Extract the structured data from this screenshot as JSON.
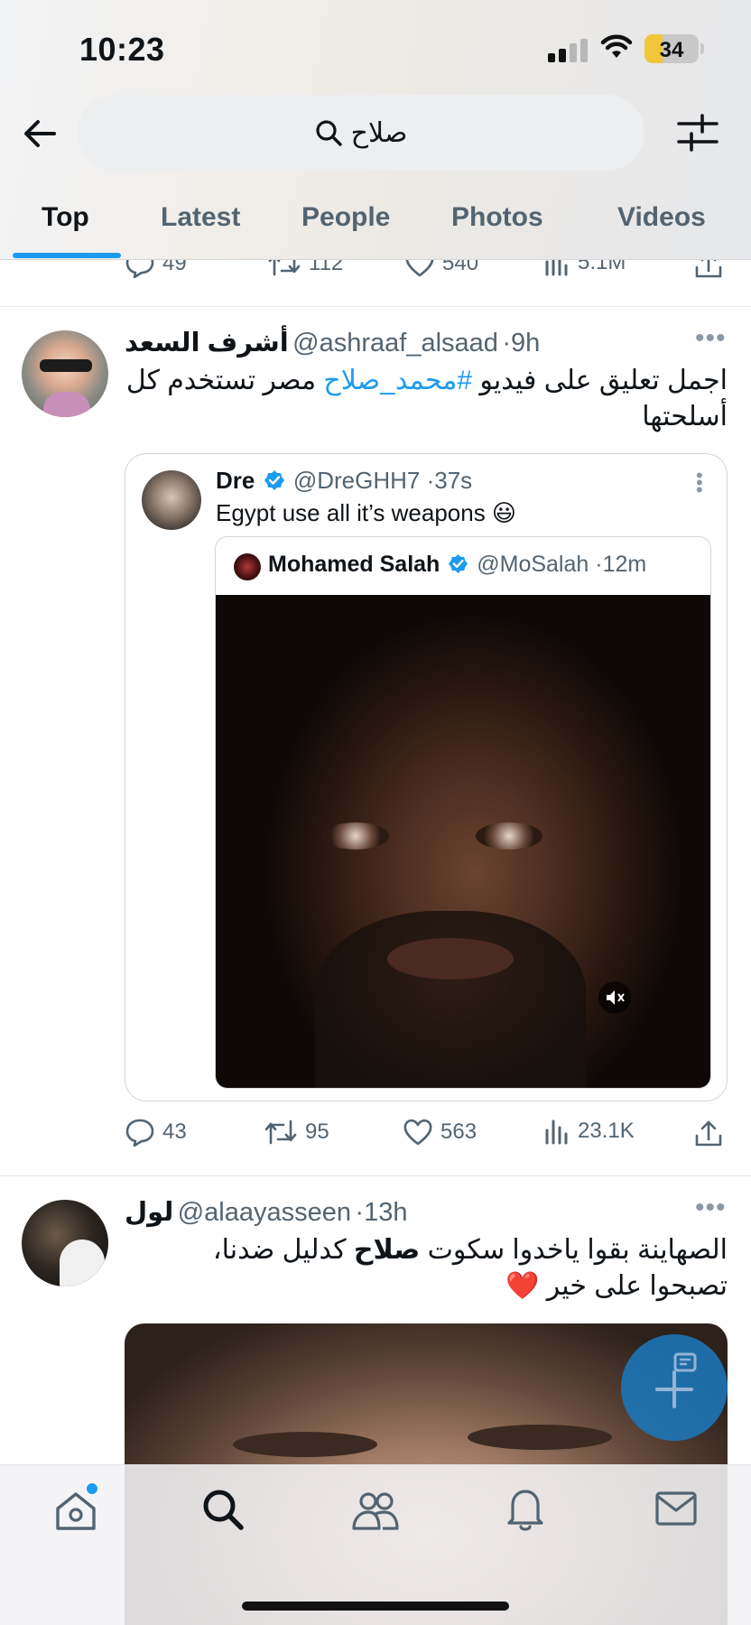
{
  "status_bar": {
    "time": "10:23",
    "battery": "34",
    "battery_level": 0.34
  },
  "header": {
    "search": {
      "query": "صلاح"
    },
    "tabs": [
      {
        "label": "Top",
        "active": true
      },
      {
        "label": "Latest",
        "active": false
      },
      {
        "label": "People",
        "active": false
      },
      {
        "label": "Photos",
        "active": false
      },
      {
        "label": "Videos",
        "active": false
      }
    ]
  },
  "previous_tweet_actions": {
    "replies": "49",
    "retweets": "112",
    "likes": "540",
    "views": "5.1M"
  },
  "tweets": [
    {
      "name": "أشرف السعد",
      "handle": "@ashraaf_alsaad",
      "time": "9h",
      "text_part1": "اجمل تعليق على فيديو",
      "hashtag": "#محمد_صلاح",
      "text_part2": "مصر تستخدم كل أسلحتها",
      "quote": {
        "name": "Dre",
        "handle": "@DreGHH7",
        "time": "37s",
        "text": "Egypt use all it’s weapons 😃",
        "inner": {
          "name": "Mohamed Salah",
          "handle": "@MoSalah",
          "time": "12m"
        }
      },
      "actions": {
        "replies": "43",
        "retweets": "95",
        "likes": "563",
        "views": "23.1K"
      }
    },
    {
      "name": "لول",
      "handle": "@alaayasseen",
      "time": "13h",
      "text_part1": "الصهاينة بقوا ياخدوا سكوت",
      "highlight": "صلاح",
      "text_part2": "كدليل ضدنا،",
      "text_line2": "تصبحوا على خير ❤️"
    }
  ],
  "colors": {
    "accent": "#1d9bf0",
    "verified": "#1d9bf0",
    "fab": "#1d75b7",
    "notification_dot": "#1d9bf0"
  },
  "icons": [
    "back-arrow-icon",
    "search-icon",
    "filter-icon",
    "reply-icon",
    "retweet-icon",
    "like-icon",
    "views-icon",
    "share-icon",
    "verified-icon",
    "mute-icon",
    "compose-icon",
    "home-icon",
    "communities-icon",
    "bell-icon",
    "mail-icon"
  ]
}
